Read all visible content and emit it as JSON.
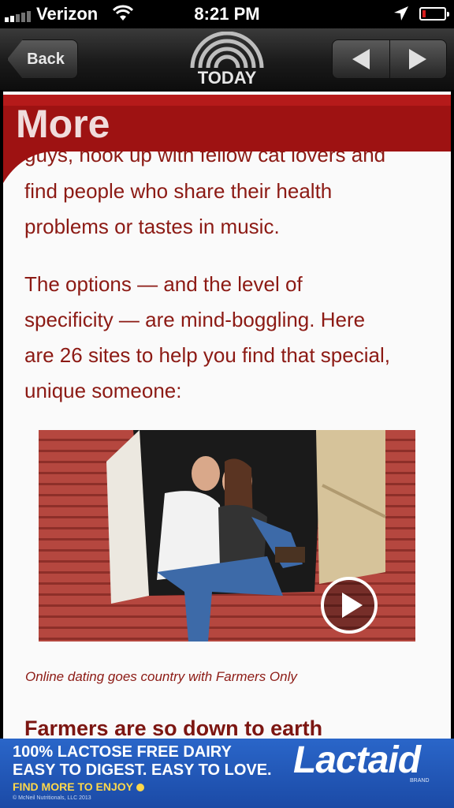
{
  "status_bar": {
    "carrier": "Verizon",
    "time": "8:21 PM",
    "battery_level": 0.15
  },
  "nav": {
    "back_label": "Back",
    "logo_text": "TODAY",
    "prev_icon": "left-arrow-icon",
    "next_icon": "right-arrow-icon"
  },
  "section_title": "More",
  "article": {
    "clipped_line": "guys, hook up with fellow cat lovers and",
    "p1_line1": "find people who share their health",
    "p1_line2": "problems or tastes in music.",
    "p2_line1": "The options — and the level of",
    "p2_line2": "specificity — are mind-boggling. Here",
    "p2_line3": "are 26 sites to help you find that special,",
    "p2_line4": "unique someone:",
    "caption": "Online dating goes country with Farmers Only",
    "next_heading": "Farmers are so down to earth"
  },
  "ad": {
    "line1": "100% LACTOSE FREE DAIRY",
    "line2": "EASY TO DIGEST. EASY TO LOVE.",
    "cta": "FIND MORE TO ENJOY",
    "legal": "© McNeil Nutritionals, LLC 2013",
    "brand": "Lactaid",
    "brand_sub": "BRAND"
  },
  "colors": {
    "accent": "#9e1212",
    "text": "#8c1a14",
    "ad_bg": "#1f54b4"
  }
}
